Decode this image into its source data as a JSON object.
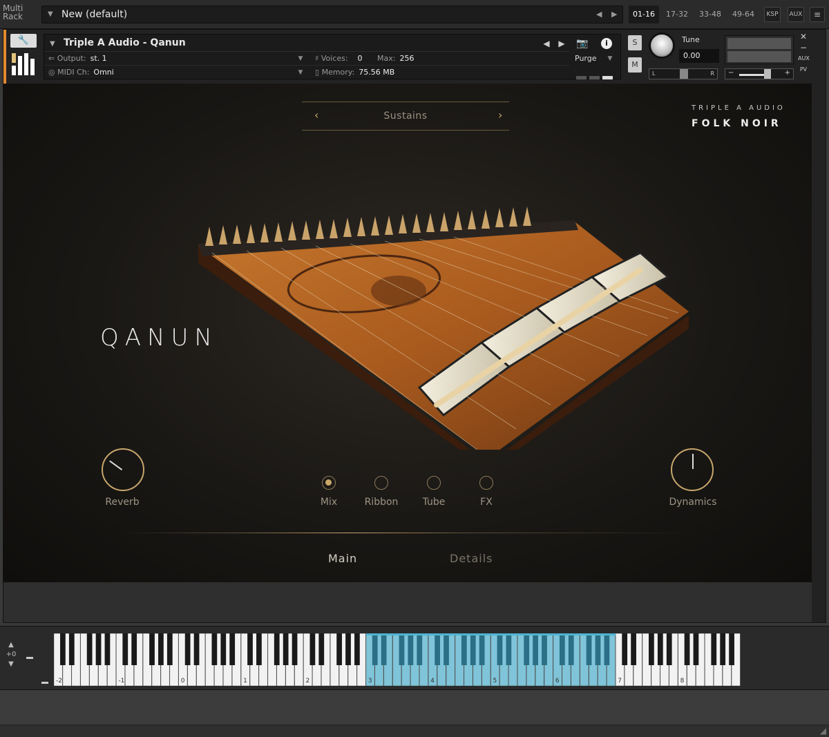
{
  "topbar": {
    "multi_rack_label": "Multi\nRack",
    "rack_title": "New (default)",
    "pages": [
      "01-16",
      "17-32",
      "33-48",
      "49-64"
    ],
    "active_page": "01-16",
    "buttons": [
      "KSP",
      "AUX"
    ]
  },
  "header": {
    "instrument_name": "Triple A Audio - Qanun",
    "output_label": "Output:",
    "output_value": "st. 1",
    "midi_label": "MIDI Ch:",
    "midi_value": "Omni",
    "voices_label": "Voices:",
    "voices_value": "0",
    "max_label": "Max:",
    "max_value": "256",
    "memory_label": "Memory:",
    "memory_value": "75.56 MB",
    "purge_label": "Purge",
    "solo_label": "S",
    "mute_label": "M",
    "tune_label": "Tune",
    "tune_value": "0.00",
    "pan_left": "L",
    "pan_right": "R",
    "vol_minus": "−",
    "vol_plus": "+",
    "side_aux": "AUX",
    "side_pv": "PV"
  },
  "gui": {
    "preset": "Sustains",
    "brand_top": "TRIPLE A AUDIO",
    "brand_main": "FOLK NOIR",
    "instrument_title": "QANUN",
    "knobs": {
      "reverb": {
        "label": "Reverb",
        "level": 0.3
      },
      "dynamics": {
        "label": "Dynamics",
        "level": 0.5
      }
    },
    "mix_options": [
      {
        "label": "Mix",
        "selected": true
      },
      {
        "label": "Ribbon",
        "selected": false
      },
      {
        "label": "Tube",
        "selected": false
      },
      {
        "label": "FX",
        "selected": false
      }
    ],
    "tabs": {
      "main": "Main",
      "details": "Details"
    }
  },
  "keyboard": {
    "octave_offset": "+0",
    "octave_labels": [
      "-2",
      "-1",
      "0",
      "1",
      "2",
      "3",
      "4",
      "5",
      "6",
      "7",
      "8"
    ],
    "key_color": "#7fc4d8",
    "mapped_start_octave": "3",
    "mapped_end_octave": "6"
  }
}
